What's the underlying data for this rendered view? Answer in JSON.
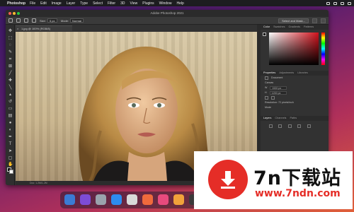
{
  "menubar": {
    "app_name": "Photoshop",
    "items": [
      "File",
      "Edit",
      "Image",
      "Layer",
      "Type",
      "Select",
      "Filter",
      "3D",
      "View",
      "Plugins",
      "Window",
      "Help"
    ]
  },
  "window": {
    "title": "Adobe Photoshop 2021",
    "traffic_colors": [
      "#ff5f57",
      "#febc2e",
      "#28c840"
    ]
  },
  "options_bar": {
    "size_label": "Size:",
    "size_value": "5 px",
    "mode_label": "Mode:",
    "mode_value": "Normal",
    "button_label": "Select and Mask..."
  },
  "document": {
    "tab_label": "1.jpg @ 100% (RGB/8)",
    "status_text": "Doc: 1.2M/1.2M"
  },
  "panels": {
    "color_tabs": [
      "Color",
      "Swatches",
      "Gradients",
      "Patterns"
    ],
    "properties_tabs": [
      "Properties",
      "Adjustments",
      "Libraries"
    ],
    "doc_label": "Document",
    "canvas_label": "Canvas",
    "width_label": "W",
    "width_value": "1920 px",
    "height_label": "H",
    "height_value": "1200 px",
    "resolution_text": "Resolution: 72 pixels/inch",
    "mode_text": "Mode",
    "layers_tabs": [
      "Layers",
      "Channels",
      "Paths"
    ]
  },
  "dock": {
    "app_colors": [
      "#3b7bd4",
      "#7d4cd6",
      "#9aa3ad",
      "#2d8cf0",
      "#d9d9d9",
      "#f06a3c",
      "#e84a7d",
      "#f2a23a",
      "#3a3a3a"
    ]
  },
  "watermark": {
    "title": "7n下载站",
    "url": "www.7ndn.com"
  },
  "colors": {
    "accent": "#e52d27",
    "ps_panel": "#323232"
  }
}
